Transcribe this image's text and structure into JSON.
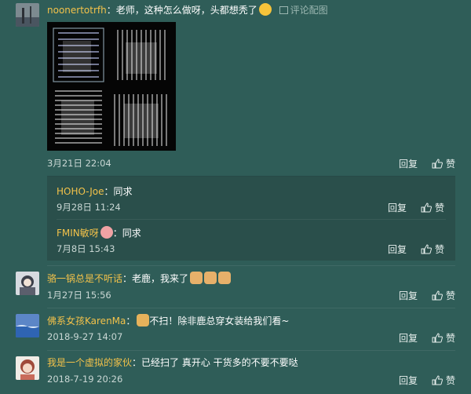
{
  "comments": [
    {
      "user": "noonertotrfh",
      "text": "：老师，这种怎么做呀，头都想秃了",
      "pic_link": "评论配图",
      "time": "3月21日 22:04",
      "reply": "回复",
      "like": "赞"
    },
    {
      "user": "骆一锅总是不听话",
      "text": "：老鹿，我来了",
      "time": "1月27日 15:56",
      "reply": "回复",
      "like": "赞"
    },
    {
      "user": "佛系女孩KarenMa",
      "text_prefix": "：",
      "text": "不扫！除非鹿总穿女装给我们看~",
      "time": "2018-9-27 14:07",
      "reply": "回复",
      "like": "赞"
    },
    {
      "user": "我是一个虚拟的家伙",
      "text": "：已经扫了 真开心 干货多的不要不要哒",
      "time": "2018-7-19 20:26",
      "reply": "回复",
      "like": "赞"
    }
  ],
  "replies": [
    {
      "user": "HOHO-Joe",
      "text": "：同求",
      "time": "9月28日 11:24",
      "reply": "回复",
      "like": "赞"
    },
    {
      "user": "FMIN敏呀",
      "text": "：同求",
      "time": "7月8日 15:43",
      "reply": "回复",
      "like": "赞"
    }
  ],
  "icons": [
    "emoji-sweat-icon",
    "picture-icon",
    "thumbs-up-icon",
    "emoji-cat-icon",
    "emoji-doge-icon",
    "emoji-love-icon"
  ],
  "colors": {
    "background": "#2f5d58",
    "username": "#f3c24a",
    "reply_box": "#2a4f4b"
  }
}
